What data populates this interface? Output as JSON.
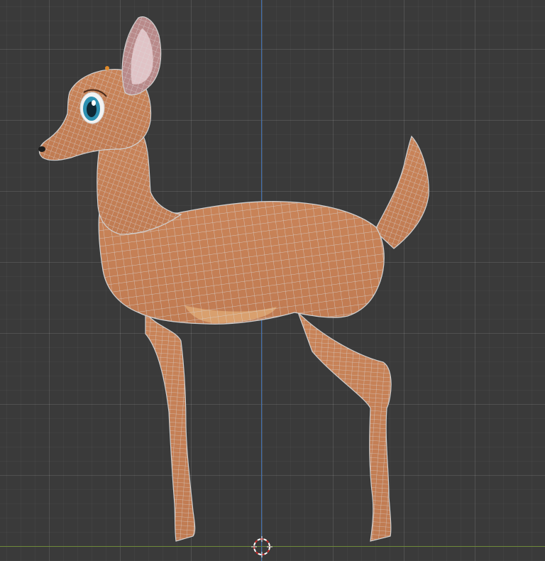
{
  "viewport": {
    "background_color": "#3a3a3a",
    "grid_color": "#4a4a4a",
    "axis_y_color": "#3f6fb0",
    "axis_x_color": "#6f8a3a"
  },
  "model": {
    "skin_color": "#c9845a",
    "belly_color": "#d8a070",
    "wire_color": "#d6d6d6",
    "eye_color": "#2d8fb0"
  },
  "icons": {
    "cursor": "3d-cursor-icon"
  }
}
